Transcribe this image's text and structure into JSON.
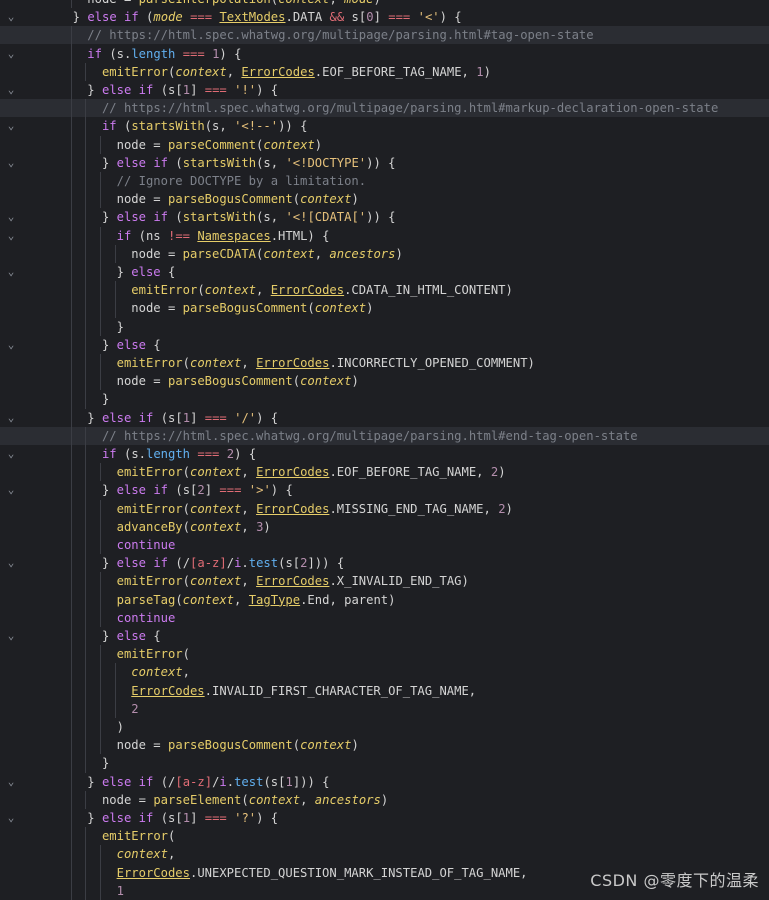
{
  "watermark": "CSDN @零度下的温柔",
  "lines": [
    {
      "fold": false,
      "indent": 5,
      "tokens": [
        [
          "plain",
          "node = "
        ],
        [
          "fn",
          "parseInterpolation"
        ],
        [
          "plain",
          "("
        ],
        [
          "var",
          "context"
        ],
        [
          "plain",
          ", "
        ],
        [
          "var",
          "mode"
        ],
        [
          "plain",
          ")"
        ]
      ]
    },
    {
      "fold": true,
      "indent": 4,
      "tokens": [
        [
          "plain",
          "} "
        ],
        [
          "kw",
          "else if"
        ],
        [
          "plain",
          " ("
        ],
        [
          "var",
          "mode"
        ],
        [
          "plain",
          " "
        ],
        [
          "op",
          "==="
        ],
        [
          "plain",
          " "
        ],
        [
          "cls",
          "TextModes"
        ],
        [
          "plain",
          ".DATA "
        ],
        [
          "op",
          "&&"
        ],
        [
          "plain",
          " s["
        ],
        [
          "num",
          "0"
        ],
        [
          "plain",
          "] "
        ],
        [
          "op",
          "==="
        ],
        [
          "plain",
          " "
        ],
        [
          "str",
          "'<'"
        ],
        [
          "plain",
          ") {"
        ]
      ]
    },
    {
      "fold": false,
      "indent": 5,
      "hl": true,
      "tokens": [
        [
          "com",
          "// https://html.spec.whatwg.org/multipage/parsing.html#tag-open-state"
        ]
      ]
    },
    {
      "fold": true,
      "indent": 5,
      "tokens": [
        [
          "kw",
          "if"
        ],
        [
          "plain",
          " (s."
        ],
        [
          "prop",
          "length"
        ],
        [
          "plain",
          " "
        ],
        [
          "op",
          "==="
        ],
        [
          "plain",
          " "
        ],
        [
          "num",
          "1"
        ],
        [
          "plain",
          ") {"
        ]
      ]
    },
    {
      "fold": false,
      "indent": 6,
      "tokens": [
        [
          "fn",
          "emitError"
        ],
        [
          "plain",
          "("
        ],
        [
          "var",
          "context"
        ],
        [
          "plain",
          ", "
        ],
        [
          "cls",
          "ErrorCodes"
        ],
        [
          "plain",
          ".EOF_BEFORE_TAG_NAME, "
        ],
        [
          "num",
          "1"
        ],
        [
          "plain",
          ")"
        ]
      ]
    },
    {
      "fold": true,
      "indent": 5,
      "tokens": [
        [
          "plain",
          "} "
        ],
        [
          "kw",
          "else if"
        ],
        [
          "plain",
          " (s["
        ],
        [
          "num",
          "1"
        ],
        [
          "plain",
          "] "
        ],
        [
          "op",
          "==="
        ],
        [
          "plain",
          " "
        ],
        [
          "str",
          "'!'"
        ],
        [
          "plain",
          ") {"
        ]
      ]
    },
    {
      "fold": false,
      "indent": 6,
      "hl": true,
      "tokens": [
        [
          "com",
          "// https://html.spec.whatwg.org/multipage/parsing.html#markup-declaration-open-state"
        ]
      ]
    },
    {
      "fold": true,
      "indent": 6,
      "tokens": [
        [
          "kw",
          "if"
        ],
        [
          "plain",
          " ("
        ],
        [
          "fn",
          "startsWith"
        ],
        [
          "plain",
          "(s, "
        ],
        [
          "str",
          "'<!--'"
        ],
        [
          "plain",
          ")) {"
        ]
      ]
    },
    {
      "fold": false,
      "indent": 7,
      "tokens": [
        [
          "plain",
          "node = "
        ],
        [
          "fn",
          "parseComment"
        ],
        [
          "plain",
          "("
        ],
        [
          "var",
          "context"
        ],
        [
          "plain",
          ")"
        ]
      ]
    },
    {
      "fold": true,
      "indent": 6,
      "tokens": [
        [
          "plain",
          "} "
        ],
        [
          "kw",
          "else if"
        ],
        [
          "plain",
          " ("
        ],
        [
          "fn",
          "startsWith"
        ],
        [
          "plain",
          "(s, "
        ],
        [
          "str",
          "'<!DOCTYPE'"
        ],
        [
          "plain",
          ")) {"
        ]
      ]
    },
    {
      "fold": false,
      "indent": 7,
      "tokens": [
        [
          "com",
          "// Ignore DOCTYPE by a limitation."
        ]
      ]
    },
    {
      "fold": false,
      "indent": 7,
      "tokens": [
        [
          "plain",
          "node = "
        ],
        [
          "fn",
          "parseBogusComment"
        ],
        [
          "plain",
          "("
        ],
        [
          "var",
          "context"
        ],
        [
          "plain",
          ")"
        ]
      ]
    },
    {
      "fold": true,
      "indent": 6,
      "tokens": [
        [
          "plain",
          "} "
        ],
        [
          "kw",
          "else if"
        ],
        [
          "plain",
          " ("
        ],
        [
          "fn",
          "startsWith"
        ],
        [
          "plain",
          "(s, "
        ],
        [
          "str",
          "'<![CDATA['"
        ],
        [
          "plain",
          ")) {"
        ]
      ]
    },
    {
      "fold": true,
      "indent": 7,
      "tokens": [
        [
          "kw",
          "if"
        ],
        [
          "plain",
          " (ns "
        ],
        [
          "op",
          "!=="
        ],
        [
          "plain",
          " "
        ],
        [
          "cls",
          "Namespaces"
        ],
        [
          "plain",
          ".HTML) {"
        ]
      ]
    },
    {
      "fold": false,
      "indent": 8,
      "tokens": [
        [
          "plain",
          "node = "
        ],
        [
          "fn",
          "parseCDATA"
        ],
        [
          "plain",
          "("
        ],
        [
          "var",
          "context"
        ],
        [
          "plain",
          ", "
        ],
        [
          "var",
          "ancestors"
        ],
        [
          "plain",
          ")"
        ]
      ]
    },
    {
      "fold": true,
      "indent": 7,
      "tokens": [
        [
          "plain",
          "} "
        ],
        [
          "kw",
          "else"
        ],
        [
          "plain",
          " {"
        ]
      ]
    },
    {
      "fold": false,
      "indent": 8,
      "tokens": [
        [
          "fn",
          "emitError"
        ],
        [
          "plain",
          "("
        ],
        [
          "var",
          "context"
        ],
        [
          "plain",
          ", "
        ],
        [
          "cls",
          "ErrorCodes"
        ],
        [
          "plain",
          ".CDATA_IN_HTML_CONTENT)"
        ]
      ]
    },
    {
      "fold": false,
      "indent": 8,
      "tokens": [
        [
          "plain",
          "node = "
        ],
        [
          "fn",
          "parseBogusComment"
        ],
        [
          "plain",
          "("
        ],
        [
          "var",
          "context"
        ],
        [
          "plain",
          ")"
        ]
      ]
    },
    {
      "fold": false,
      "indent": 7,
      "tokens": [
        [
          "plain",
          "}"
        ]
      ]
    },
    {
      "fold": true,
      "indent": 6,
      "tokens": [
        [
          "plain",
          "} "
        ],
        [
          "kw",
          "else"
        ],
        [
          "plain",
          " {"
        ]
      ]
    },
    {
      "fold": false,
      "indent": 7,
      "tokens": [
        [
          "fn",
          "emitError"
        ],
        [
          "plain",
          "("
        ],
        [
          "var",
          "context"
        ],
        [
          "plain",
          ", "
        ],
        [
          "cls",
          "ErrorCodes"
        ],
        [
          "plain",
          ".INCORRECTLY_OPENED_COMMENT)"
        ]
      ]
    },
    {
      "fold": false,
      "indent": 7,
      "tokens": [
        [
          "plain",
          "node = "
        ],
        [
          "fn",
          "parseBogusComment"
        ],
        [
          "plain",
          "("
        ],
        [
          "var",
          "context"
        ],
        [
          "plain",
          ")"
        ]
      ]
    },
    {
      "fold": false,
      "indent": 6,
      "tokens": [
        [
          "plain",
          "}"
        ]
      ]
    },
    {
      "fold": true,
      "indent": 5,
      "tokens": [
        [
          "plain",
          "} "
        ],
        [
          "kw",
          "else if"
        ],
        [
          "plain",
          " (s["
        ],
        [
          "num",
          "1"
        ],
        [
          "plain",
          "] "
        ],
        [
          "op",
          "==="
        ],
        [
          "plain",
          " "
        ],
        [
          "str",
          "'/'"
        ],
        [
          "plain",
          ") {"
        ]
      ]
    },
    {
      "fold": false,
      "indent": 6,
      "hl": true,
      "tokens": [
        [
          "com",
          "// https://html.spec.whatwg.org/multipage/parsing.html#end-tag-open-state"
        ]
      ]
    },
    {
      "fold": true,
      "indent": 6,
      "tokens": [
        [
          "kw",
          "if"
        ],
        [
          "plain",
          " (s."
        ],
        [
          "prop",
          "length"
        ],
        [
          "plain",
          " "
        ],
        [
          "op",
          "==="
        ],
        [
          "plain",
          " "
        ],
        [
          "num",
          "2"
        ],
        [
          "plain",
          ") {"
        ]
      ]
    },
    {
      "fold": false,
      "indent": 7,
      "tokens": [
        [
          "fn",
          "emitError"
        ],
        [
          "plain",
          "("
        ],
        [
          "var",
          "context"
        ],
        [
          "plain",
          ", "
        ],
        [
          "cls",
          "ErrorCodes"
        ],
        [
          "plain",
          ".EOF_BEFORE_TAG_NAME, "
        ],
        [
          "num",
          "2"
        ],
        [
          "plain",
          ")"
        ]
      ]
    },
    {
      "fold": true,
      "indent": 6,
      "tokens": [
        [
          "plain",
          "} "
        ],
        [
          "kw",
          "else if"
        ],
        [
          "plain",
          " (s["
        ],
        [
          "num",
          "2"
        ],
        [
          "plain",
          "] "
        ],
        [
          "op",
          "==="
        ],
        [
          "plain",
          " "
        ],
        [
          "str",
          "'>'"
        ],
        [
          "plain",
          ") {"
        ]
      ]
    },
    {
      "fold": false,
      "indent": 7,
      "tokens": [
        [
          "fn",
          "emitError"
        ],
        [
          "plain",
          "("
        ],
        [
          "var",
          "context"
        ],
        [
          "plain",
          ", "
        ],
        [
          "cls",
          "ErrorCodes"
        ],
        [
          "plain",
          ".MISSING_END_TAG_NAME, "
        ],
        [
          "num",
          "2"
        ],
        [
          "plain",
          ")"
        ]
      ]
    },
    {
      "fold": false,
      "indent": 7,
      "tokens": [
        [
          "fn",
          "advanceBy"
        ],
        [
          "plain",
          "("
        ],
        [
          "var",
          "context"
        ],
        [
          "plain",
          ", "
        ],
        [
          "num",
          "3"
        ],
        [
          "plain",
          ")"
        ]
      ]
    },
    {
      "fold": false,
      "indent": 7,
      "tokens": [
        [
          "kw",
          "continue"
        ]
      ]
    },
    {
      "fold": true,
      "indent": 6,
      "tokens": [
        [
          "plain",
          "} "
        ],
        [
          "kw",
          "else if"
        ],
        [
          "plain",
          " (/"
        ],
        [
          "red",
          "[a-z]"
        ],
        [
          "plain",
          "/"
        ],
        [
          "kw",
          "i"
        ],
        [
          "plain",
          "."
        ],
        [
          "prop",
          "test"
        ],
        [
          "plain",
          "(s["
        ],
        [
          "num",
          "2"
        ],
        [
          "plain",
          "])) {"
        ]
      ]
    },
    {
      "fold": false,
      "indent": 7,
      "tokens": [
        [
          "fn",
          "emitError"
        ],
        [
          "plain",
          "("
        ],
        [
          "var",
          "context"
        ],
        [
          "plain",
          ", "
        ],
        [
          "cls",
          "ErrorCodes"
        ],
        [
          "plain",
          ".X_INVALID_END_TAG)"
        ]
      ]
    },
    {
      "fold": false,
      "indent": 7,
      "tokens": [
        [
          "fn",
          "parseTag"
        ],
        [
          "plain",
          "("
        ],
        [
          "var",
          "context"
        ],
        [
          "plain",
          ", "
        ],
        [
          "cls",
          "TagType"
        ],
        [
          "plain",
          ".End, parent)"
        ]
      ]
    },
    {
      "fold": false,
      "indent": 7,
      "tokens": [
        [
          "kw",
          "continue"
        ]
      ]
    },
    {
      "fold": true,
      "indent": 6,
      "tokens": [
        [
          "plain",
          "} "
        ],
        [
          "kw",
          "else"
        ],
        [
          "plain",
          " {"
        ]
      ]
    },
    {
      "fold": false,
      "indent": 7,
      "tokens": [
        [
          "fn",
          "emitError"
        ],
        [
          "plain",
          "("
        ]
      ]
    },
    {
      "fold": false,
      "indent": 8,
      "tokens": [
        [
          "var",
          "context"
        ],
        [
          "plain",
          ","
        ]
      ]
    },
    {
      "fold": false,
      "indent": 8,
      "tokens": [
        [
          "cls",
          "ErrorCodes"
        ],
        [
          "plain",
          ".INVALID_FIRST_CHARACTER_OF_TAG_NAME,"
        ]
      ]
    },
    {
      "fold": false,
      "indent": 8,
      "tokens": [
        [
          "num",
          "2"
        ]
      ]
    },
    {
      "fold": false,
      "indent": 7,
      "tokens": [
        [
          "plain",
          ")"
        ]
      ]
    },
    {
      "fold": false,
      "indent": 7,
      "tokens": [
        [
          "plain",
          "node = "
        ],
        [
          "fn",
          "parseBogusComment"
        ],
        [
          "plain",
          "("
        ],
        [
          "var",
          "context"
        ],
        [
          "plain",
          ")"
        ]
      ]
    },
    {
      "fold": false,
      "indent": 6,
      "tokens": [
        [
          "plain",
          "}"
        ]
      ]
    },
    {
      "fold": true,
      "indent": 5,
      "tokens": [
        [
          "plain",
          "} "
        ],
        [
          "kw",
          "else if"
        ],
        [
          "plain",
          " (/"
        ],
        [
          "red",
          "[a-z]"
        ],
        [
          "plain",
          "/"
        ],
        [
          "kw",
          "i"
        ],
        [
          "plain",
          "."
        ],
        [
          "prop",
          "test"
        ],
        [
          "plain",
          "(s["
        ],
        [
          "num",
          "1"
        ],
        [
          "plain",
          "])) {"
        ]
      ]
    },
    {
      "fold": false,
      "indent": 6,
      "tokens": [
        [
          "plain",
          "node = "
        ],
        [
          "fn",
          "parseElement"
        ],
        [
          "plain",
          "("
        ],
        [
          "var",
          "context"
        ],
        [
          "plain",
          ", "
        ],
        [
          "var",
          "ancestors"
        ],
        [
          "plain",
          ")"
        ]
      ]
    },
    {
      "fold": true,
      "indent": 5,
      "tokens": [
        [
          "plain",
          "} "
        ],
        [
          "kw",
          "else if"
        ],
        [
          "plain",
          " (s["
        ],
        [
          "num",
          "1"
        ],
        [
          "plain",
          "] "
        ],
        [
          "op",
          "==="
        ],
        [
          "plain",
          " "
        ],
        [
          "str",
          "'?'"
        ],
        [
          "plain",
          ") {"
        ]
      ]
    },
    {
      "fold": false,
      "indent": 6,
      "tokens": [
        [
          "fn",
          "emitError"
        ],
        [
          "plain",
          "("
        ]
      ]
    },
    {
      "fold": false,
      "indent": 7,
      "tokens": [
        [
          "var",
          "context"
        ],
        [
          "plain",
          ","
        ]
      ]
    },
    {
      "fold": false,
      "indent": 7,
      "tokens": [
        [
          "cls",
          "ErrorCodes"
        ],
        [
          "plain",
          ".UNEXPECTED_QUESTION_MARK_INSTEAD_OF_TAG_NAME,"
        ]
      ]
    },
    {
      "fold": false,
      "indent": 7,
      "tokens": [
        [
          "num",
          "1"
        ]
      ]
    }
  ]
}
